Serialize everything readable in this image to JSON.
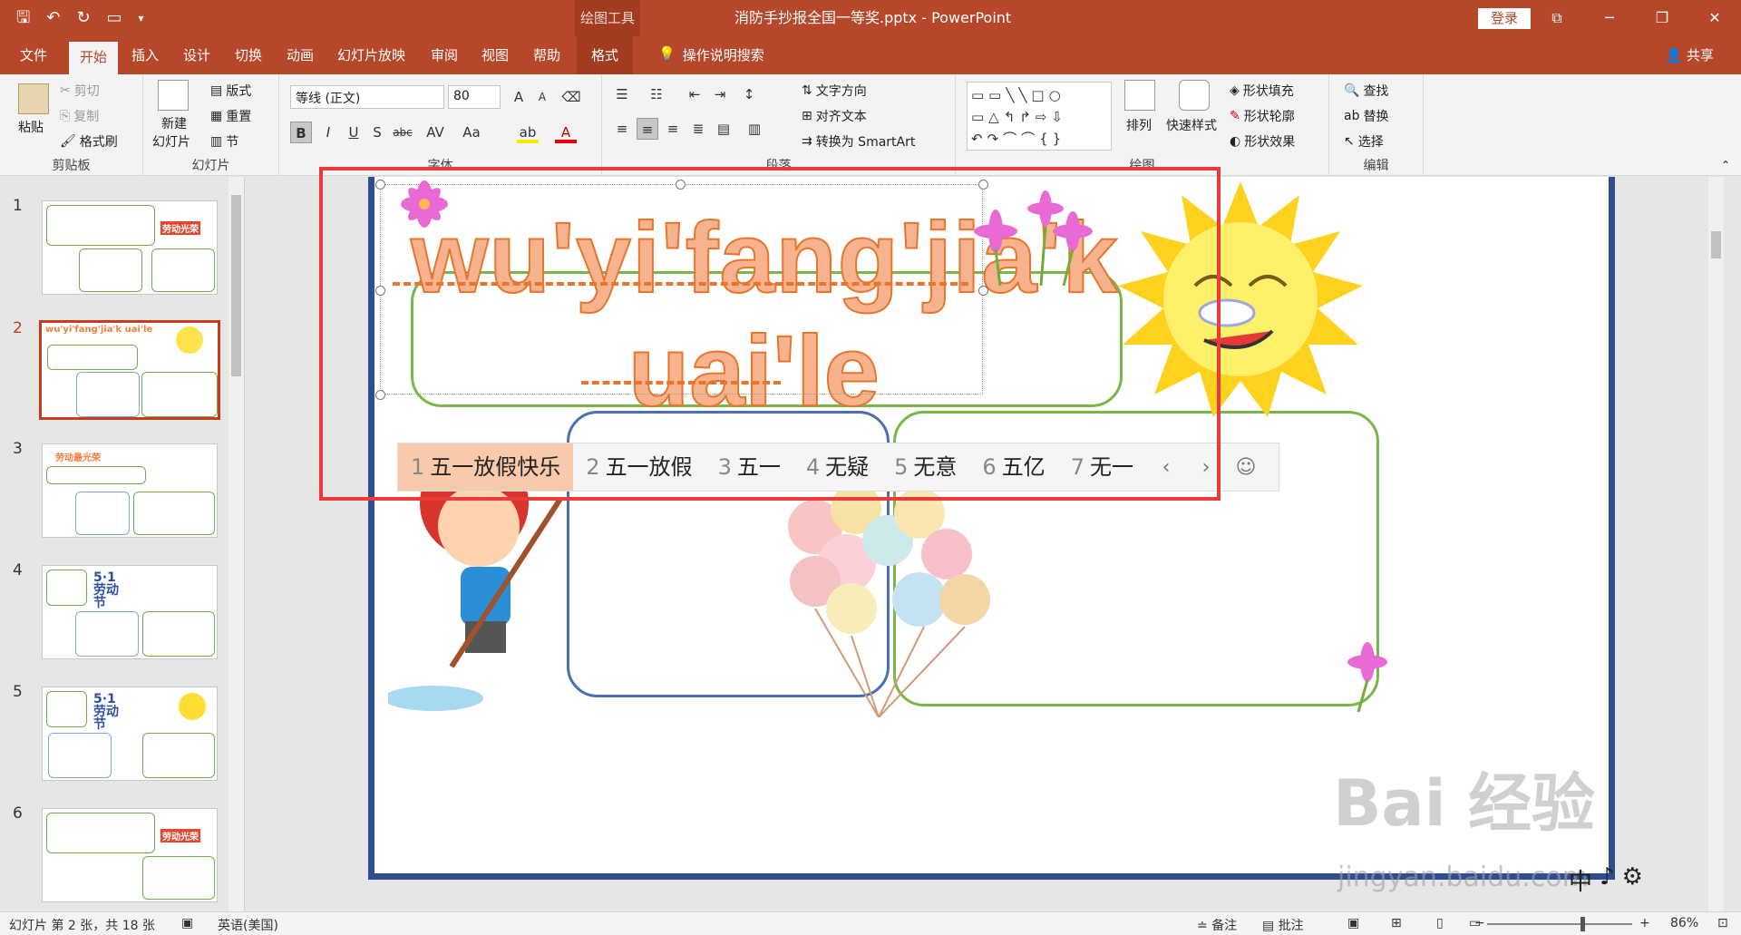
{
  "titlebar": {
    "context_tab": "绘图工具",
    "doc_title": "消防手抄报全国一等奖.pptx - PowerPoint",
    "login": "登录"
  },
  "tabs": [
    "文件",
    "开始",
    "插入",
    "设计",
    "切换",
    "动画",
    "幻灯片放映",
    "审阅",
    "视图",
    "帮助",
    "格式"
  ],
  "tellme": "操作说明搜索",
  "share": "共享",
  "ribbon": {
    "clipboard": {
      "paste": "粘贴",
      "cut": "剪切",
      "copy": "复制",
      "format_painter": "格式刷",
      "label": "剪贴板"
    },
    "slides": {
      "new_slide_1": "新建",
      "new_slide_2": "幻灯片",
      "layout": "版式",
      "reset": "重置",
      "section": "节",
      "label": "幻灯片"
    },
    "font": {
      "name": "等线 (正文)",
      "size": "80",
      "label": "字体"
    },
    "paragraph": {
      "text_direction": "文字方向",
      "align_text": "对齐文本",
      "smartart": "转换为 SmartArt",
      "label": "段落"
    },
    "drawing": {
      "arrange": "排列",
      "quick_styles": "快速样式",
      "fill": "形状填充",
      "outline": "形状轮廓",
      "effects": "形状效果",
      "label": "绘图"
    },
    "editing": {
      "find": "查找",
      "replace": "替换",
      "select": "选择",
      "label": "编辑"
    }
  },
  "thumbnails": [
    {
      "num": "1",
      "tag": "劳动光荣"
    },
    {
      "num": "2",
      "tag": "wu'yi'fang'jia'k uai'le"
    },
    {
      "num": "3",
      "tag": "劳动最光荣"
    },
    {
      "num": "4",
      "tag": "5·1劳动节"
    },
    {
      "num": "5",
      "tag": "5·1劳动节"
    },
    {
      "num": "6",
      "tag": "劳动光荣"
    }
  ],
  "slide": {
    "pinyin_line1": "wu'yi'fang'jia'k",
    "pinyin_line2": "uai'le"
  },
  "ime": {
    "candidates": [
      {
        "n": "1",
        "text": "五一放假快乐"
      },
      {
        "n": "2",
        "text": "五一放假"
      },
      {
        "n": "3",
        "text": "五一"
      },
      {
        "n": "4",
        "text": "无疑"
      },
      {
        "n": "5",
        "text": "无意"
      },
      {
        "n": "6",
        "text": "五亿"
      },
      {
        "n": "7",
        "text": "无一"
      }
    ],
    "prev": "‹",
    "next": "›",
    "emoji": "☺",
    "mode": "中",
    "mode_extra": "♪"
  },
  "watermark": {
    "main": "Bai 经验",
    "sub": "jingyan.baidu.com"
  },
  "status": {
    "slide_info": "幻灯片 第 2 张，共 18 张",
    "language": "英语(美国)",
    "notes": "备注",
    "comments": "批注",
    "zoom": "86%"
  },
  "colors": {
    "accent": "#b7472a",
    "highlight": "#ea3a3a",
    "candidate_selected": "#f9c9ac",
    "pinyin_fill": "#f6b38d",
    "pinyin_stroke": "#e9752d"
  }
}
